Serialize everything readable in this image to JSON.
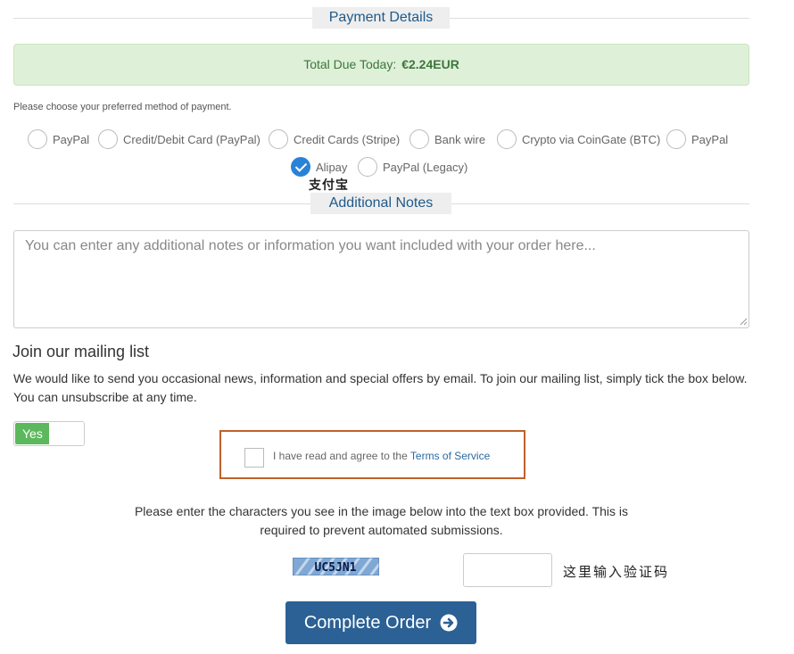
{
  "payment_section": {
    "title": "Payment Details"
  },
  "total_due": {
    "label": "Total Due Today:",
    "amount": "€2.24EUR"
  },
  "payment_methods": {
    "prompt": "Please choose your preferred method of payment.",
    "selected": "Alipay",
    "options": [
      {
        "label": "PayPal",
        "checked": false
      },
      {
        "label": "Credit/Debit Card (PayPal)",
        "checked": false
      },
      {
        "label": "Credit Cards (Stripe)",
        "checked": false
      },
      {
        "label": "Bank wire",
        "checked": false
      },
      {
        "label": "Crypto via CoinGate (BTC)",
        "checked": false
      },
      {
        "label": "PayPal",
        "checked": false
      },
      {
        "label": "Alipay",
        "checked": true,
        "sublabel": "支付宝"
      },
      {
        "label": "PayPal (Legacy)",
        "checked": false
      }
    ]
  },
  "notes_section": {
    "title": "Additional Notes",
    "placeholder": "You can enter any additional notes or information you want included with your order here..."
  },
  "mailing": {
    "title": "Join our mailing list",
    "description": "We would like to send you occasional news, information and special offers by email. To join our mailing list, simply tick the box below. You can unsubscribe at any time.",
    "toggle_label": "Yes"
  },
  "tos": {
    "label": "I have read and agree to the ",
    "link": "Terms of Service",
    "checked": false
  },
  "captcha": {
    "instructions": "Please enter the characters you see in the image below into the text box provided. This is required to prevent automated submissions.",
    "code": "UC5JN1",
    "hint": "这里输入验证码"
  },
  "submit": {
    "label": "Complete Order",
    "icon": "arrow-circle-right-icon"
  },
  "colors": {
    "accent": "#2b6195",
    "success_bg": "#dff0d8",
    "success_text": "#3c763d",
    "toggle_on": "#5cb85c",
    "highlight_border": "#c0602a",
    "radio_checked": "#2a82d7"
  }
}
